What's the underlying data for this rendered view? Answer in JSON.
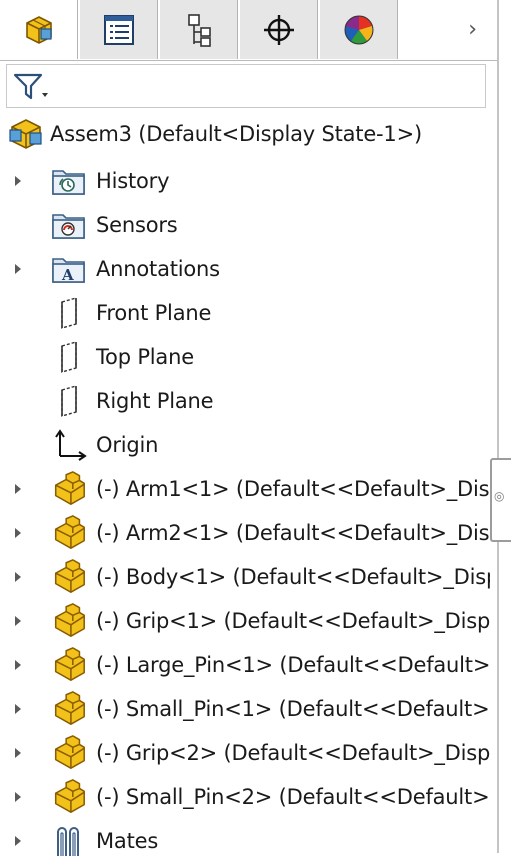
{
  "tabs": [
    {
      "icon": "feature-manager-icon",
      "active": true
    },
    {
      "icon": "property-manager-icon",
      "active": false
    },
    {
      "icon": "configuration-manager-icon",
      "active": false
    },
    {
      "icon": "dimxpert-manager-icon",
      "active": false
    },
    {
      "icon": "display-manager-icon",
      "active": false
    }
  ],
  "tab_scroll_glyph": "›",
  "filter": {
    "icon": "filter-icon"
  },
  "root": {
    "label": "Assem3  (Default<Display State-1>)",
    "icon": "assembly-icon"
  },
  "items": [
    {
      "label": "History",
      "icon": "history-folder-icon",
      "expandable": true
    },
    {
      "label": "Sensors",
      "icon": "sensors-folder-icon",
      "expandable": false
    },
    {
      "label": "Annotations",
      "icon": "annotations-folder-icon",
      "expandable": true
    },
    {
      "label": "Front Plane",
      "icon": "plane-icon",
      "expandable": false
    },
    {
      "label": "Top Plane",
      "icon": "plane-icon",
      "expandable": false
    },
    {
      "label": "Right Plane",
      "icon": "plane-icon",
      "expandable": false
    },
    {
      "label": "Origin",
      "icon": "origin-icon",
      "expandable": false
    },
    {
      "label": "(-) Arm1<1> (Default<<Default>_Dis",
      "icon": "part-icon",
      "expandable": true
    },
    {
      "label": "(-) Arm2<1> (Default<<Default>_Dis",
      "icon": "part-icon",
      "expandable": true
    },
    {
      "label": "(-) Body<1> (Default<<Default>_Disp",
      "icon": "part-icon",
      "expandable": true
    },
    {
      "label": "(-) Grip<1> (Default<<Default>_Disp",
      "icon": "part-icon",
      "expandable": true
    },
    {
      "label": "(-) Large_Pin<1> (Default<<Default>",
      "icon": "part-icon",
      "expandable": true
    },
    {
      "label": "(-) Small_Pin<1> (Default<<Default>",
      "icon": "part-icon",
      "expandable": true
    },
    {
      "label": "(-) Grip<2> (Default<<Default>_Disp",
      "icon": "part-icon",
      "expandable": true
    },
    {
      "label": "(-) Small_Pin<2> (Default<<Default>",
      "icon": "part-icon",
      "expandable": true
    },
    {
      "label": "Mates",
      "icon": "mates-icon",
      "expandable": true
    }
  ],
  "colors": {
    "part_yellow": "#f2c21b",
    "part_outline": "#9a6a00",
    "assembly_blue": "#5aa0d8"
  }
}
